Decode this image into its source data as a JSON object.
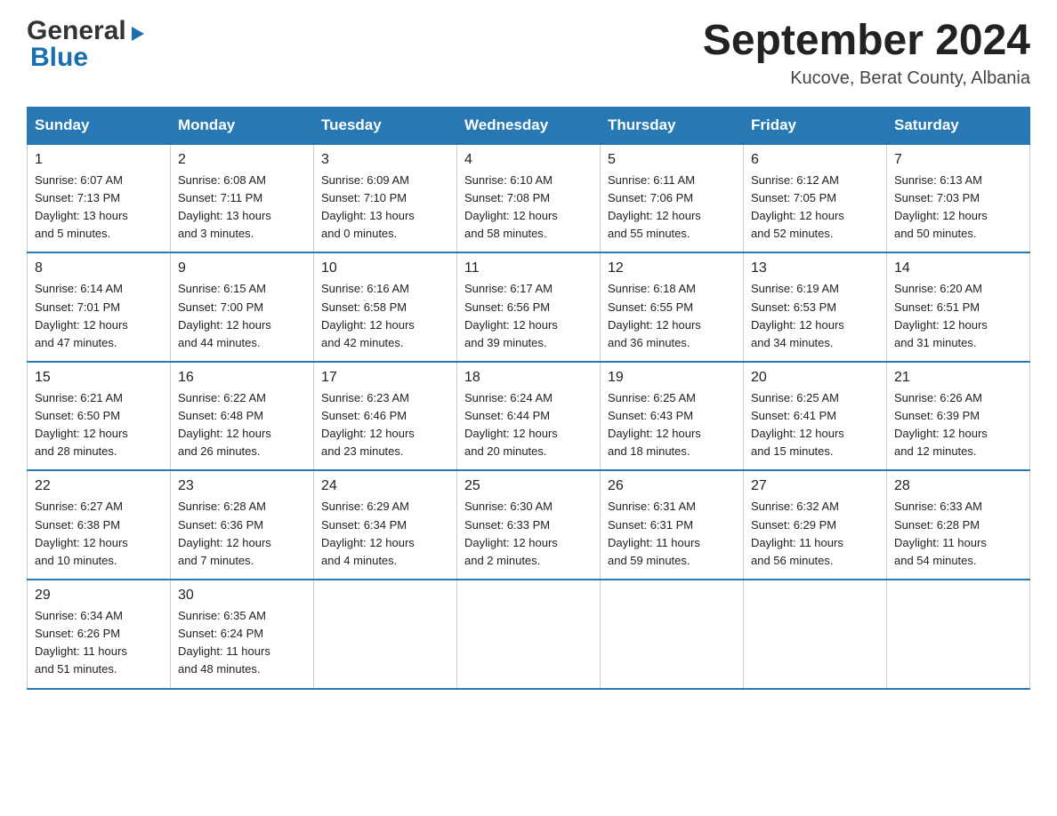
{
  "header": {
    "logo_general": "General",
    "logo_blue": "Blue",
    "title": "September 2024",
    "subtitle": "Kucove, Berat County, Albania"
  },
  "weekdays": [
    "Sunday",
    "Monday",
    "Tuesday",
    "Wednesday",
    "Thursday",
    "Friday",
    "Saturday"
  ],
  "weeks": [
    [
      {
        "day": "1",
        "sunrise": "6:07 AM",
        "sunset": "7:13 PM",
        "daylight": "13 hours and 5 minutes."
      },
      {
        "day": "2",
        "sunrise": "6:08 AM",
        "sunset": "7:11 PM",
        "daylight": "13 hours and 3 minutes."
      },
      {
        "day": "3",
        "sunrise": "6:09 AM",
        "sunset": "7:10 PM",
        "daylight": "13 hours and 0 minutes."
      },
      {
        "day": "4",
        "sunrise": "6:10 AM",
        "sunset": "7:08 PM",
        "daylight": "12 hours and 58 minutes."
      },
      {
        "day": "5",
        "sunrise": "6:11 AM",
        "sunset": "7:06 PM",
        "daylight": "12 hours and 55 minutes."
      },
      {
        "day": "6",
        "sunrise": "6:12 AM",
        "sunset": "7:05 PM",
        "daylight": "12 hours and 52 minutes."
      },
      {
        "day": "7",
        "sunrise": "6:13 AM",
        "sunset": "7:03 PM",
        "daylight": "12 hours and 50 minutes."
      }
    ],
    [
      {
        "day": "8",
        "sunrise": "6:14 AM",
        "sunset": "7:01 PM",
        "daylight": "12 hours and 47 minutes."
      },
      {
        "day": "9",
        "sunrise": "6:15 AM",
        "sunset": "7:00 PM",
        "daylight": "12 hours and 44 minutes."
      },
      {
        "day": "10",
        "sunrise": "6:16 AM",
        "sunset": "6:58 PM",
        "daylight": "12 hours and 42 minutes."
      },
      {
        "day": "11",
        "sunrise": "6:17 AM",
        "sunset": "6:56 PM",
        "daylight": "12 hours and 39 minutes."
      },
      {
        "day": "12",
        "sunrise": "6:18 AM",
        "sunset": "6:55 PM",
        "daylight": "12 hours and 36 minutes."
      },
      {
        "day": "13",
        "sunrise": "6:19 AM",
        "sunset": "6:53 PM",
        "daylight": "12 hours and 34 minutes."
      },
      {
        "day": "14",
        "sunrise": "6:20 AM",
        "sunset": "6:51 PM",
        "daylight": "12 hours and 31 minutes."
      }
    ],
    [
      {
        "day": "15",
        "sunrise": "6:21 AM",
        "sunset": "6:50 PM",
        "daylight": "12 hours and 28 minutes."
      },
      {
        "day": "16",
        "sunrise": "6:22 AM",
        "sunset": "6:48 PM",
        "daylight": "12 hours and 26 minutes."
      },
      {
        "day": "17",
        "sunrise": "6:23 AM",
        "sunset": "6:46 PM",
        "daylight": "12 hours and 23 minutes."
      },
      {
        "day": "18",
        "sunrise": "6:24 AM",
        "sunset": "6:44 PM",
        "daylight": "12 hours and 20 minutes."
      },
      {
        "day": "19",
        "sunrise": "6:25 AM",
        "sunset": "6:43 PM",
        "daylight": "12 hours and 18 minutes."
      },
      {
        "day": "20",
        "sunrise": "6:25 AM",
        "sunset": "6:41 PM",
        "daylight": "12 hours and 15 minutes."
      },
      {
        "day": "21",
        "sunrise": "6:26 AM",
        "sunset": "6:39 PM",
        "daylight": "12 hours and 12 minutes."
      }
    ],
    [
      {
        "day": "22",
        "sunrise": "6:27 AM",
        "sunset": "6:38 PM",
        "daylight": "12 hours and 10 minutes."
      },
      {
        "day": "23",
        "sunrise": "6:28 AM",
        "sunset": "6:36 PM",
        "daylight": "12 hours and 7 minutes."
      },
      {
        "day": "24",
        "sunrise": "6:29 AM",
        "sunset": "6:34 PM",
        "daylight": "12 hours and 4 minutes."
      },
      {
        "day": "25",
        "sunrise": "6:30 AM",
        "sunset": "6:33 PM",
        "daylight": "12 hours and 2 minutes."
      },
      {
        "day": "26",
        "sunrise": "6:31 AM",
        "sunset": "6:31 PM",
        "daylight": "11 hours and 59 minutes."
      },
      {
        "day": "27",
        "sunrise": "6:32 AM",
        "sunset": "6:29 PM",
        "daylight": "11 hours and 56 minutes."
      },
      {
        "day": "28",
        "sunrise": "6:33 AM",
        "sunset": "6:28 PM",
        "daylight": "11 hours and 54 minutes."
      }
    ],
    [
      {
        "day": "29",
        "sunrise": "6:34 AM",
        "sunset": "6:26 PM",
        "daylight": "11 hours and 51 minutes."
      },
      {
        "day": "30",
        "sunrise": "6:35 AM",
        "sunset": "6:24 PM",
        "daylight": "11 hours and 48 minutes."
      },
      null,
      null,
      null,
      null,
      null
    ]
  ]
}
